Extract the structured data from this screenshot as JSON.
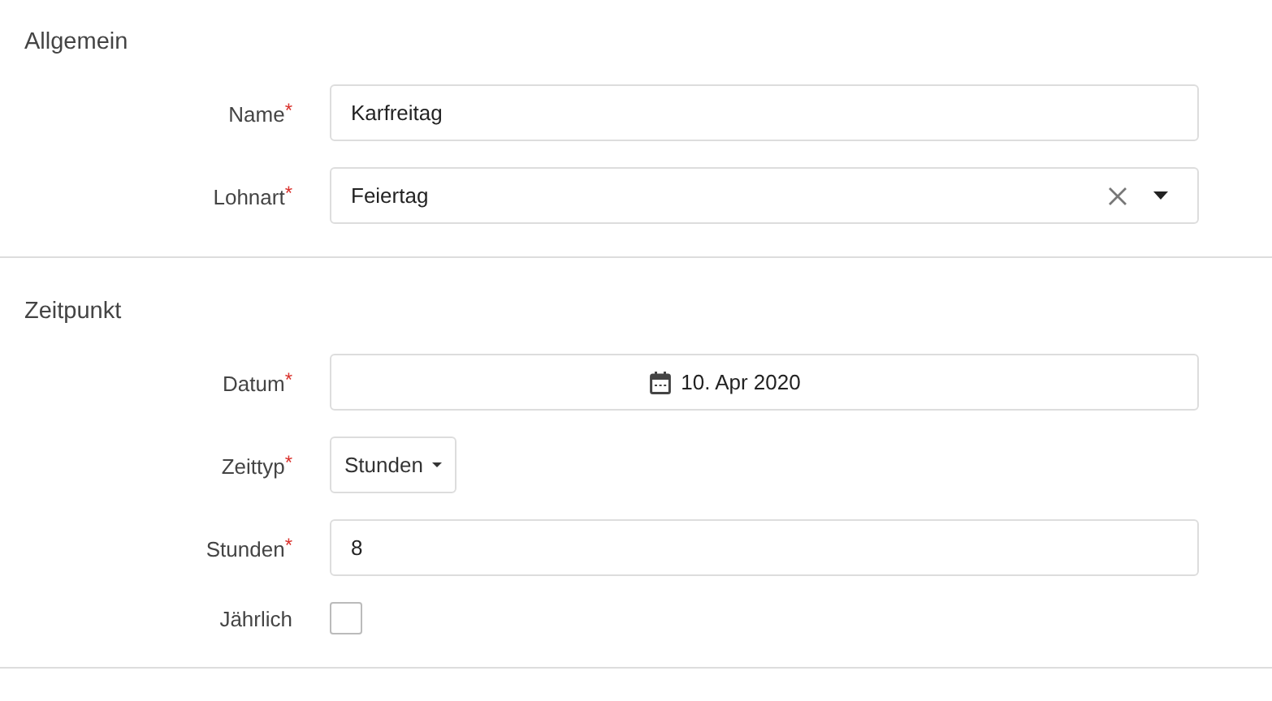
{
  "sections": [
    {
      "title": "Allgemein",
      "fields": [
        {
          "kind": "text",
          "label": "Name",
          "mark": "*",
          "value": "Karfreitag"
        },
        {
          "kind": "select",
          "label": "Lohnart",
          "mark": "*",
          "value": "Feiertag"
        }
      ]
    },
    {
      "title": "Zeitpunkt",
      "fields": [
        {
          "kind": "date",
          "label": "Datum",
          "mark": "*",
          "value": "10. Apr 2020"
        },
        {
          "kind": "dropdown",
          "label": "Zeittyp",
          "mark": "*",
          "value": "Stunden"
        },
        {
          "kind": "text",
          "label": "Stunden",
          "mark": "*",
          "value": "8"
        },
        {
          "kind": "checkbox",
          "label": "Jährlich",
          "checked": false
        }
      ]
    }
  ]
}
